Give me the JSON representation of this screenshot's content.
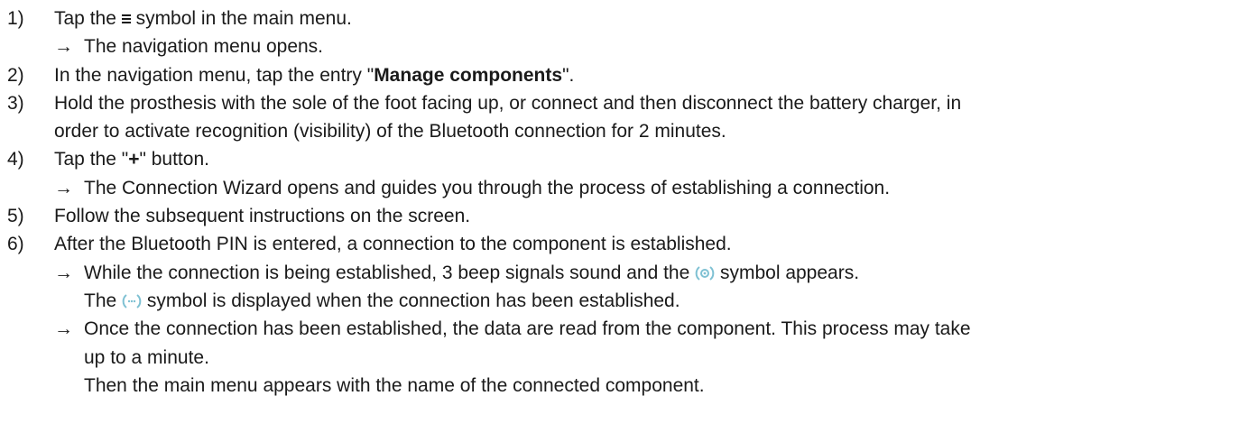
{
  "steps": [
    {
      "num": "1)",
      "pre": "Tap the ",
      "icon": "menu-icon",
      "post": " symbol in the main menu.",
      "result": "The navigation menu opens."
    },
    {
      "num": "2)",
      "pre": "In the navigation menu, tap the entry \"",
      "bold": "Manage components",
      "post": "\"."
    },
    {
      "num": "3)",
      "line1": "Hold the prosthesis with the sole of the foot facing up, or connect and then disconnect the battery charger, in",
      "line2": "order to activate recognition (visibility) of the Bluetooth connection for 2 minutes."
    },
    {
      "num": "4)",
      "pre": "Tap the \"",
      "bold": "+",
      "post": "\" button.",
      "result": "The Connection Wizard opens and guides you through the process of establishing a connection."
    },
    {
      "num": "5)",
      "text": "Follow the subsequent instructions on the screen."
    },
    {
      "num": "6)",
      "text": "After the Bluetooth PIN is entered, a connection to the component is established.",
      "result1": {
        "pre": "While the connection is being established, 3 beep signals sound and the ",
        "icon": "bluetooth-connecting-icon",
        "post": " symbol appears."
      },
      "result1b": {
        "pre": "The ",
        "icon": "bluetooth-connected-icon",
        "post": " symbol is displayed when the connection has been established."
      },
      "result2": {
        "line1": "Once the connection has been established, the data are read from the component. This process may take",
        "line2": "up to a minute.",
        "line3": "Then the main menu appears with the name of the connected component."
      }
    }
  ],
  "arrow": "→",
  "colors": {
    "text": "#1a1a1a",
    "icon_accent": "#7fc1d3"
  }
}
